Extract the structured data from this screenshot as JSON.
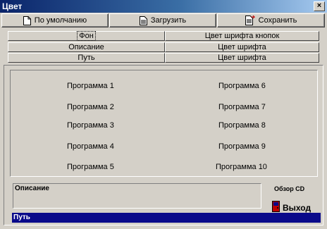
{
  "window": {
    "title": "Цвет",
    "close_glyph": "×"
  },
  "toolbar": {
    "default_label": "По умолчанию",
    "load_label": "Загрузить",
    "save_label": "Сохранить"
  },
  "options": {
    "background": "Фон",
    "button_font_color": "Цвет шрифта кнопок",
    "description": "Описание",
    "font_color_1": "Цвет шрифта",
    "path": "Путь",
    "font_color_2": "Цвет шрифта"
  },
  "programs": {
    "left": [
      "Программа 1",
      "Программа 2",
      "Программа 3",
      "Программа 4",
      "Программа 5"
    ],
    "right": [
      "Программа 6",
      "Программа 7",
      "Программа 8",
      "Программа 9",
      "Программа 10"
    ]
  },
  "description_box": {
    "label": "Описание"
  },
  "path_bar": {
    "label": "Путь"
  },
  "cd_browse": {
    "label": "Обзор CD"
  },
  "exit": {
    "label": "Выход"
  },
  "colors": {
    "window_bg": "#d4d0c8",
    "title_start": "#0a246a",
    "title_end": "#a6caf0",
    "path_bar_bg": "#0a0a8a",
    "exit_icon": "#c00000"
  }
}
